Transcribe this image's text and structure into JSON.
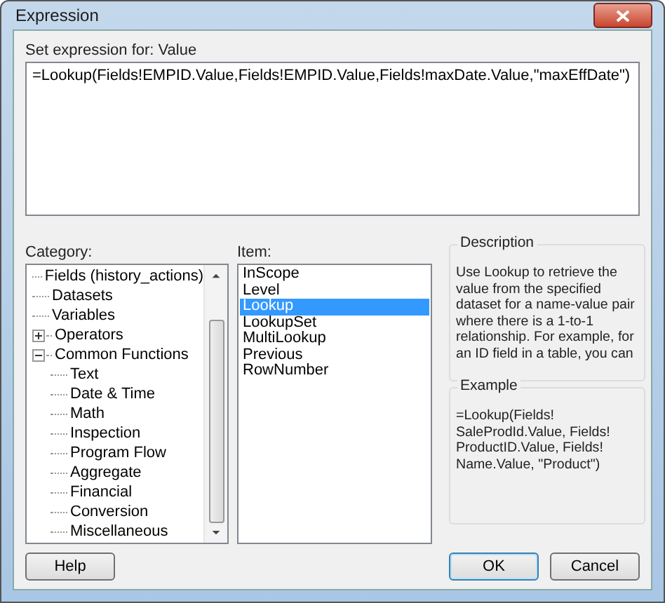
{
  "window": {
    "title": "Expression"
  },
  "expression": {
    "label": "Set expression for: Value",
    "value": "=Lookup(Fields!EMPID.Value,Fields!EMPID.Value,Fields!maxDate.Value,\"maxEffDate\")"
  },
  "category": {
    "label": "Category:",
    "tree": [
      {
        "label": "Fields (history_actions)"
      },
      {
        "label": "Datasets"
      },
      {
        "label": "Variables"
      },
      {
        "label": "Operators",
        "expanded": false
      },
      {
        "label": "Common Functions",
        "expanded": true,
        "children": [
          {
            "label": "Text"
          },
          {
            "label": "Date & Time"
          },
          {
            "label": "Math"
          },
          {
            "label": "Inspection"
          },
          {
            "label": "Program Flow"
          },
          {
            "label": "Aggregate"
          },
          {
            "label": "Financial"
          },
          {
            "label": "Conversion"
          },
          {
            "label": "Miscellaneous"
          }
        ]
      }
    ]
  },
  "item": {
    "label": "Item:",
    "items": [
      {
        "label": "InScope",
        "selected": false
      },
      {
        "label": "Level",
        "selected": false
      },
      {
        "label": "Lookup",
        "selected": true
      },
      {
        "label": "LookupSet",
        "selected": false
      },
      {
        "label": "MultiLookup",
        "selected": false
      },
      {
        "label": "Previous",
        "selected": false
      },
      {
        "label": "RowNumber",
        "selected": false
      }
    ]
  },
  "description": {
    "title": "Description",
    "text": "Use Lookup to retrieve the value from the specified dataset for a name-value pair where there is a 1-to-1 relationship. For example, for an ID field in a table, you can"
  },
  "example": {
    "title": "Example",
    "text": "=Lookup(Fields! SaleProdId.Value, Fields! ProductID.Value,  Fields! Name.Value, \"Product\")"
  },
  "buttons": [
    {
      "label": "Help",
      "kind": "help"
    },
    {
      "label": "OK",
      "kind": "default"
    },
    {
      "label": "Cancel",
      "kind": "cancel"
    }
  ]
}
